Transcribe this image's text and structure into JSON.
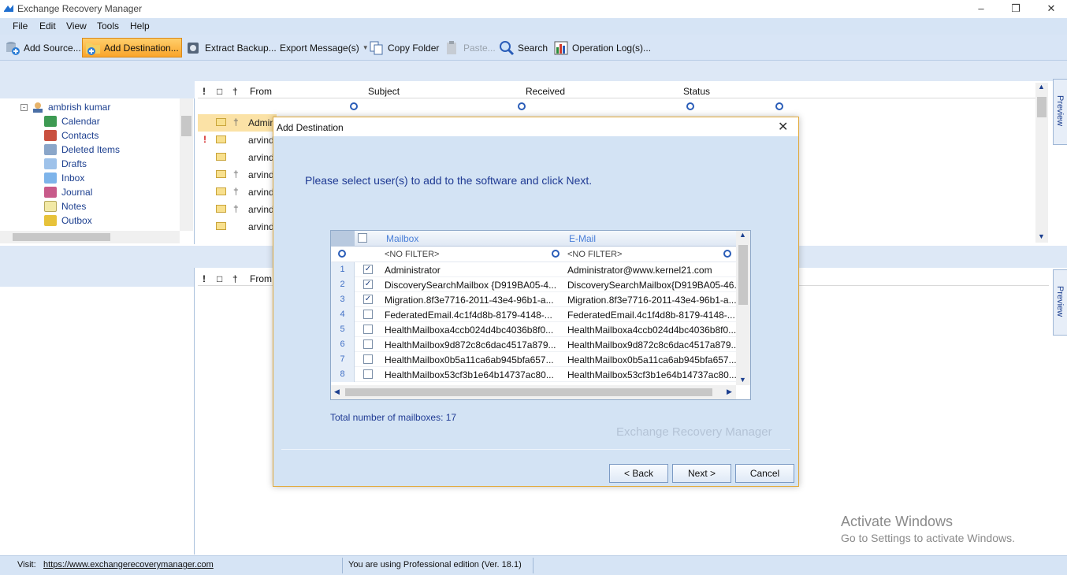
{
  "window": {
    "title": "Exchange Recovery Manager",
    "minimize_glyph": "–",
    "maximize_glyph": "❒",
    "close_glyph": "✕"
  },
  "menu": [
    "File",
    "Edit",
    "View",
    "Tools",
    "Help"
  ],
  "toolbar": {
    "add_source": "Add Source...",
    "add_destination": "Add Destination...",
    "extract_backup": "Extract Backup...",
    "export_messages": "Export Message(s)",
    "copy_folder": "Copy Folder",
    "paste": "Paste...",
    "search": "Search",
    "operation_logs": "Operation Log(s)..."
  },
  "tree": {
    "root": "ambrish kumar",
    "items": [
      "Calendar",
      "Contacts",
      "Deleted Items",
      "Drafts",
      "Inbox",
      "Journal",
      "Notes",
      "Outbox"
    ]
  },
  "message_list": {
    "columns": [
      "From",
      "Subject",
      "Received",
      "Status"
    ],
    "rows": [
      "Admini",
      "arvind",
      "arvind",
      "arvind",
      "arvind",
      "arvind",
      "arvind"
    ]
  },
  "lower_list": {
    "columns": [
      "From"
    ]
  },
  "preview_label": "Preview",
  "dialog": {
    "title": "Add Destination",
    "close_glyph": "✕",
    "instruction": "Please select user(s) to add to the software and click Next.",
    "grid": {
      "col_mailbox": "Mailbox",
      "col_email": "E-Mail",
      "filter": "<NO FILTER>",
      "rows": [
        {
          "num": "1",
          "checked": true,
          "mailbox": "Administrator",
          "email": "Administrator@www.kernel21.com"
        },
        {
          "num": "2",
          "checked": true,
          "mailbox": "DiscoverySearchMailbox {D919BA05-4...",
          "email": "DiscoverySearchMailbox{D919BA05-46..."
        },
        {
          "num": "3",
          "checked": true,
          "mailbox": "Migration.8f3e7716-2011-43e4-96b1-a...",
          "email": "Migration.8f3e7716-2011-43e4-96b1-a..."
        },
        {
          "num": "4",
          "checked": false,
          "mailbox": "FederatedEmail.4c1f4d8b-8179-4148-...",
          "email": "FederatedEmail.4c1f4d8b-8179-4148-..."
        },
        {
          "num": "5",
          "checked": false,
          "mailbox": "HealthMailboxa4ccb024d4bc4036b8f0...",
          "email": "HealthMailboxa4ccb024d4bc4036b8f0..."
        },
        {
          "num": "6",
          "checked": false,
          "mailbox": "HealthMailbox9d872c8c6dac4517a879...",
          "email": "HealthMailbox9d872c8c6dac4517a879..."
        },
        {
          "num": "7",
          "checked": false,
          "mailbox": "HealthMailbox0b5a11ca6ab945bfa657...",
          "email": "HealthMailbox0b5a11ca6ab945bfa657..."
        },
        {
          "num": "8",
          "checked": false,
          "mailbox": "HealthMailbox53cf3b1e64b14737ac80...",
          "email": "HealthMailbox53cf3b1e64b14737ac80..."
        }
      ]
    },
    "total": "Total number of mailboxes: 17",
    "watermark": "Exchange Recovery Manager",
    "back": "< Back",
    "next": "Next >",
    "cancel": "Cancel"
  },
  "status": {
    "visit_label": "Visit:",
    "url": "https://www.exchangerecoverymanager.com",
    "edition": "You are using Professional edition (Ver. 18.1)"
  },
  "activate": {
    "title": "Activate Windows",
    "subtitle": "Go to Settings to activate Windows."
  },
  "colors": {
    "accent": "#f9a42b",
    "panel": "#d6e4f5",
    "link": "#1f4fbf"
  }
}
